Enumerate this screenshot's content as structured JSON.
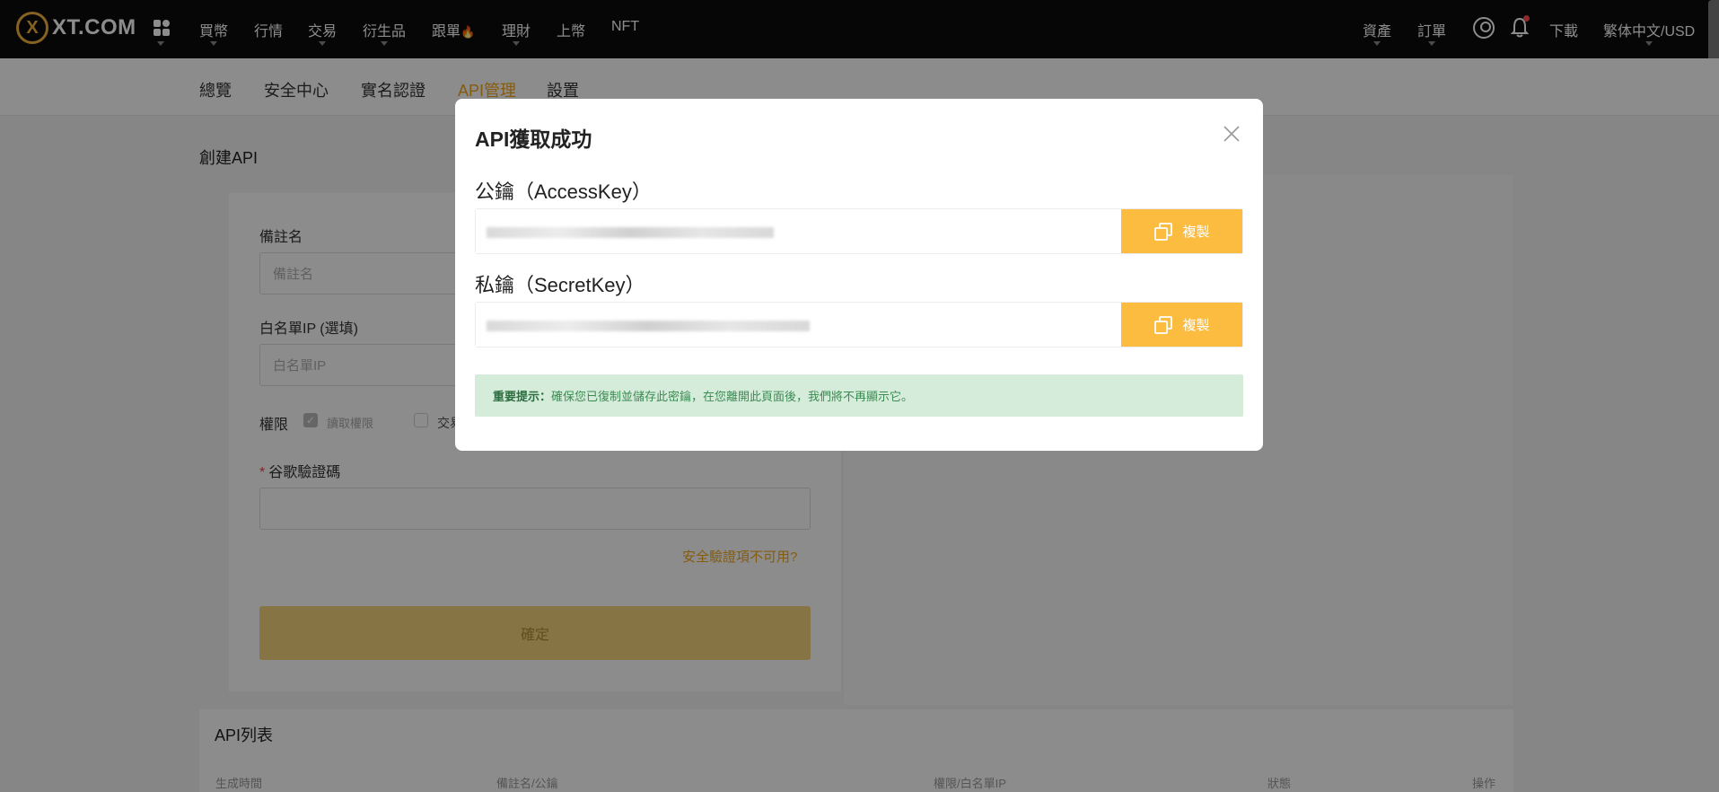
{
  "brand": {
    "logo_mark": "X",
    "logo_text": "XT.COM"
  },
  "topnav": {
    "items": [
      {
        "label": "買幣",
        "caret": true
      },
      {
        "label": "行情",
        "caret": false
      },
      {
        "label": "交易",
        "caret": true
      },
      {
        "label": "衍生品",
        "caret": true
      },
      {
        "label": "跟單",
        "caret": false,
        "badge": "fire-icon"
      },
      {
        "label": "理財",
        "caret": true
      },
      {
        "label": "上幣",
        "caret": false
      },
      {
        "label": "NFT",
        "caret": false
      }
    ],
    "right": {
      "assets": "資產",
      "orders": "訂單",
      "download": "下載",
      "locale": "繁体中文/USD"
    }
  },
  "subnav": {
    "items": [
      "總覽",
      "安全中心",
      "實名認證",
      "API管理",
      "設置"
    ],
    "active": "API管理"
  },
  "create_api": {
    "title": "創建API",
    "remark_label": "備註名",
    "remark_placeholder": "備註名",
    "whitelist_label": "白名單IP (選填)",
    "whitelist_placeholder": "白名單IP",
    "permissions_label": "權限",
    "perm_read": "讀取權限",
    "perm_trade": "交易",
    "google_label": "谷歌驗證碼",
    "unavailable_link": "安全驗證項不可用?",
    "submit": "確定"
  },
  "api_list": {
    "title": "API列表",
    "columns": [
      "生成時間",
      "備註名/公鑰",
      "權限/白名單IP",
      "狀態",
      "操作"
    ]
  },
  "modal": {
    "title": "API獲取成功",
    "access_label": "公鑰（AccessKey）",
    "secret_label": "私鑰（SecretKey）",
    "copy_label": "複製",
    "notice_strong": "重要提示：",
    "notice_text": "確保您已復制並儲存此密鑰，在您離開此頁面後，我們將不再顯示它。"
  },
  "colors": {
    "accent": "#f2a81d",
    "copy_button": "#fbbc3f",
    "notice_bg": "#d6ecdb",
    "notice_text": "#3b8a52",
    "topbar": "#0c0c0c"
  }
}
